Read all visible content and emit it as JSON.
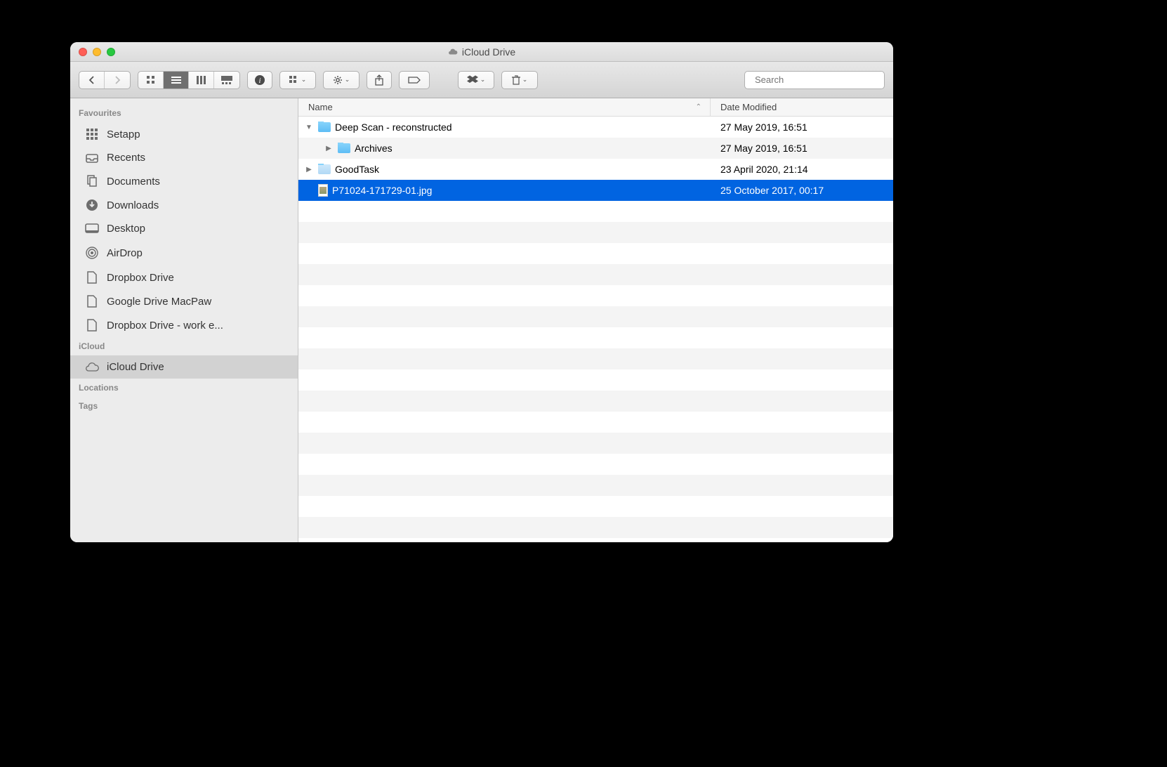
{
  "window": {
    "title": "iCloud Drive"
  },
  "search": {
    "placeholder": "Search"
  },
  "sidebar": {
    "sections": [
      {
        "label": "Favourites",
        "items": [
          {
            "label": "Setapp",
            "icon": "grid"
          },
          {
            "label": "Recents",
            "icon": "tray"
          },
          {
            "label": "Documents",
            "icon": "doc"
          },
          {
            "label": "Downloads",
            "icon": "download"
          },
          {
            "label": "Desktop",
            "icon": "desktop"
          },
          {
            "label": "AirDrop",
            "icon": "airdrop"
          },
          {
            "label": "Dropbox Drive",
            "icon": "file"
          },
          {
            "label": "Google Drive MacPaw",
            "icon": "file"
          },
          {
            "label": "Dropbox Drive - work e...",
            "icon": "file"
          }
        ]
      },
      {
        "label": "iCloud",
        "items": [
          {
            "label": "iCloud Drive",
            "icon": "cloud",
            "selected": true
          }
        ]
      },
      {
        "label": "Locations",
        "items": []
      },
      {
        "label": "Tags",
        "items": []
      }
    ]
  },
  "columns": {
    "name": "Name",
    "date": "Date Modified"
  },
  "files": [
    {
      "name": "Deep Scan - reconstructed",
      "type": "folder",
      "date": "27 May 2019, 16:51",
      "indent": 0,
      "expanded": true
    },
    {
      "name": "Archives",
      "type": "folder",
      "date": "27 May 2019, 16:51",
      "indent": 1,
      "collapsed": true
    },
    {
      "name": "GoodTask",
      "type": "appfolder",
      "date": "23 April 2020, 21:14",
      "indent": 0,
      "collapsed": true
    },
    {
      "name": "P71024-171729-01.jpg",
      "type": "image",
      "date": "25 October 2017, 00:17",
      "indent": 0,
      "selected": true
    }
  ]
}
